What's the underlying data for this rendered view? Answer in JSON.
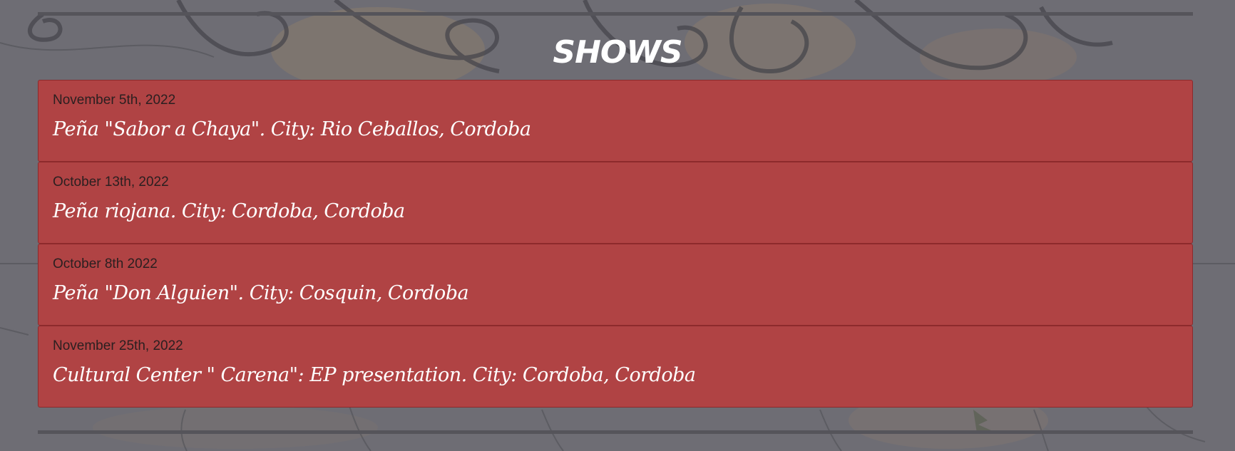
{
  "section": {
    "title": "SHOWS"
  },
  "shows": [
    {
      "date": "November 5th, 2022",
      "description": "Peña \"Sabor a Chaya\". City: Rio Ceballos, Cordoba"
    },
    {
      "date": "October 13th, 2022",
      "description": "Peña riojana. City: Cordoba, Cordoba"
    },
    {
      "date": "October 8th 2022",
      "description": "Peña \"Don Alguien\". City: Cosquin, Cordoba"
    },
    {
      "date": "November 25th, 2022",
      "description": "Cultural Center \" Carena\": EP presentation. City: Cordoba, Cordoba"
    }
  ],
  "colors": {
    "card_background": "#b04344",
    "card_border": "#8d2a2c",
    "page_background": "#6c6b70"
  }
}
